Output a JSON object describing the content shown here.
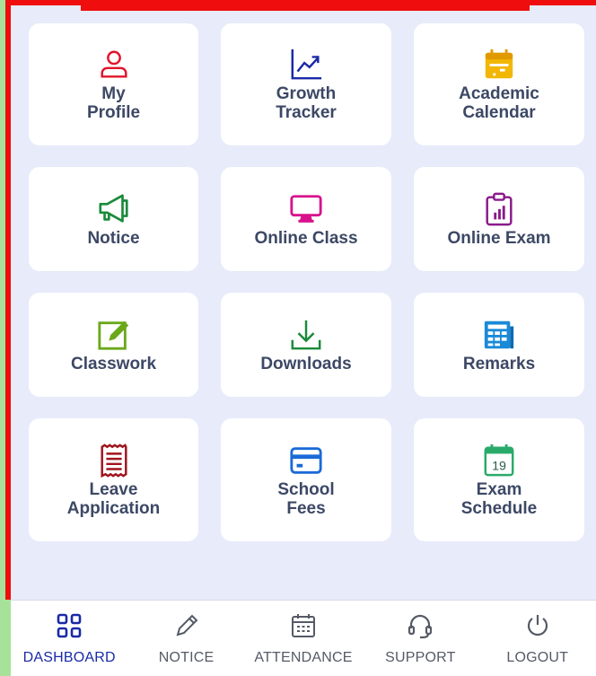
{
  "tiles": [
    {
      "label": "My\nProfile",
      "icon": "user-icon",
      "color": "#e0142a"
    },
    {
      "label": "Growth\nTracker",
      "icon": "growth-chart-icon",
      "color": "#1a2aa6"
    },
    {
      "label": "Academic\nCalendar",
      "icon": "calendar-icon",
      "color": "#f2b705"
    },
    {
      "label": "Notice",
      "icon": "megaphone-icon",
      "color": "#1a8a3a"
    },
    {
      "label": "Online Class",
      "icon": "monitor-icon",
      "color": "#d8128c"
    },
    {
      "label": "Online Exam",
      "icon": "clipboard-chart-icon",
      "color": "#8a1a8a"
    },
    {
      "label": "Classwork",
      "icon": "edit-icon",
      "color": "#6aa81a"
    },
    {
      "label": "Downloads",
      "icon": "download-icon",
      "color": "#1a8a3a"
    },
    {
      "label": "Remarks",
      "icon": "table-icon",
      "color": "#1a8ad8"
    },
    {
      "label": "Leave\nApplication",
      "icon": "receipt-icon",
      "color": "#a0141e"
    },
    {
      "label": "School\nFees",
      "icon": "card-icon",
      "color": "#1a6ad8"
    },
    {
      "label": "Exam\nSchedule",
      "icon": "calendar-19-icon",
      "color": "#2aaa6a",
      "day": "19"
    }
  ],
  "nav": [
    {
      "label": "DASHBOARD",
      "icon": "grid-icon",
      "active": true
    },
    {
      "label": "NOTICE",
      "icon": "pencil-icon",
      "active": false
    },
    {
      "label": "ATTENDANCE",
      "icon": "attendance-calendar-icon",
      "active": false
    },
    {
      "label": "SUPPORT",
      "icon": "headset-icon",
      "active": false
    },
    {
      "label": "LOGOUT",
      "icon": "power-icon",
      "active": false
    }
  ],
  "colors": {
    "frame": "#ef0d0d",
    "background": "#e7ebfa",
    "active_nav": "#1a2aa6"
  }
}
